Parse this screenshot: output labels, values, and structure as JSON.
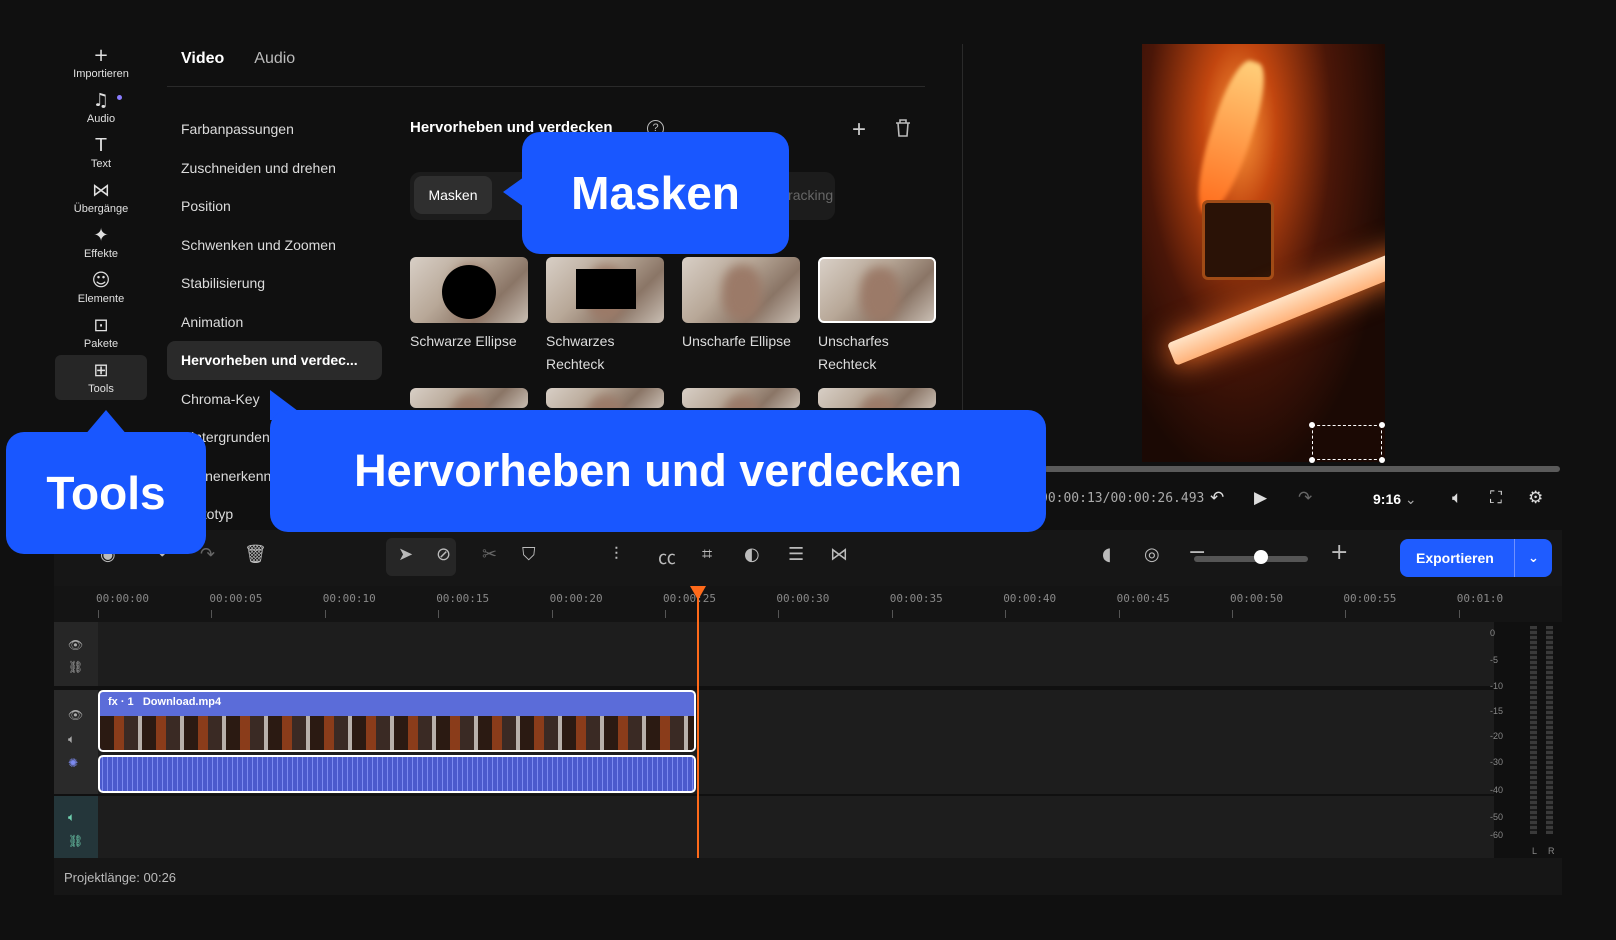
{
  "sidebar": {
    "items": [
      {
        "label": "Importieren",
        "icon": "plus-icon"
      },
      {
        "label": "Audio",
        "icon": "music-note-icon"
      },
      {
        "label": "Text",
        "icon": "text-icon"
      },
      {
        "label": "Übergänge",
        "icon": "transition-icon"
      },
      {
        "label": "Effekte",
        "icon": "sparkle-icon"
      },
      {
        "label": "Elemente",
        "icon": "smiley-icon"
      },
      {
        "label": "Pakete",
        "icon": "package-icon"
      },
      {
        "label": "Tools",
        "icon": "grid-icon"
      }
    ]
  },
  "categories": {
    "video": "Video",
    "audio": "Audio"
  },
  "menu": {
    "items": [
      "Farbanpassungen",
      "Zuschneiden und drehen",
      "Position",
      "Schwenken und Zoomen",
      "Stabilisierung",
      "Animation",
      "Hervorheben und verdec...",
      "Chroma-Key",
      "Hintergrundent",
      "Szenenerkenn",
      "Prototyp"
    ]
  },
  "panel": {
    "title": "Hervorheben und verdecken",
    "help": "?",
    "segment_active": "Masken",
    "segment_other": "Tracking",
    "effects": [
      {
        "line1": "Schwarze Ellipse",
        "line2": ""
      },
      {
        "line1": "Schwarzes",
        "line2": "Rechteck"
      },
      {
        "line1": "Unscharfe Ellipse",
        "line2": ""
      },
      {
        "line1": "Unscharfes",
        "line2": "Rechteck"
      }
    ]
  },
  "player": {
    "timecode": "00:00:13/00:00:26.493",
    "aspect": "9:16"
  },
  "toolbar": {
    "export_label": "Exportieren"
  },
  "timeline": {
    "ticks": [
      "00:00:00",
      "00:00:05",
      "00:00:10",
      "00:00:15",
      "00:00:20",
      "00:00:25",
      "00:00:30",
      "00:00:35",
      "00:00:40",
      "00:00:45",
      "00:00:50",
      "00:00:55",
      "00:01:0"
    ],
    "clip_fx": "fx · 1",
    "clip_name": "Download.mp4",
    "meter_labels": [
      "0",
      "-5",
      "-10",
      "-15",
      "-20",
      "-30",
      "-40",
      "-50",
      "-60"
    ],
    "meter_lr": [
      "L",
      "R"
    ]
  },
  "status": {
    "project_length": "Projektlänge: 00:26"
  },
  "callouts": {
    "masken": "Masken",
    "hervorheben": "Hervorheben und verdecken",
    "tools": "Tools"
  },
  "colors": {
    "accent": "#1957ff",
    "playhead": "#ff6a1a",
    "clip": "#5b6cd9"
  }
}
